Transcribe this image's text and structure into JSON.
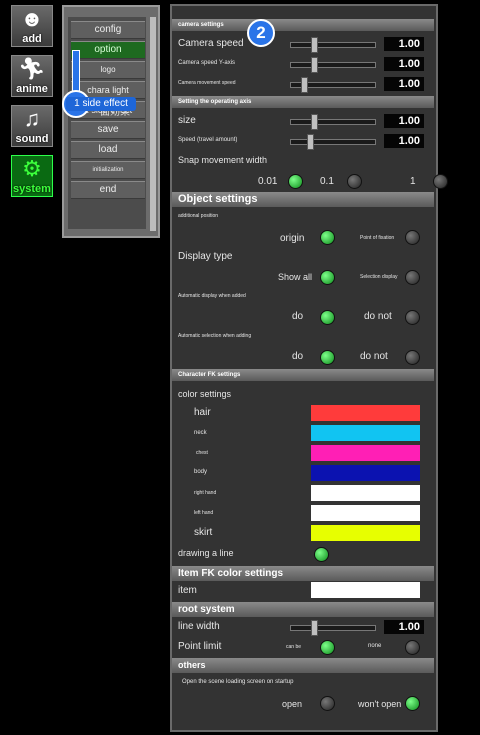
{
  "sidebar": {
    "items": [
      {
        "label": "add",
        "icon": "avatar-icon"
      },
      {
        "label": "anime",
        "icon": "running-figure-icon"
      },
      {
        "label": "sound",
        "icon": "music-note-icon"
      },
      {
        "label": "system",
        "icon": "gears-icon"
      }
    ]
  },
  "menu": {
    "items": [
      "config",
      "option",
      "logo",
      "chara light",
      "1 side effect",
      "save",
      "load",
      "initialization",
      "end"
    ],
    "overlay_text": "面効果"
  },
  "annotations": {
    "badge_1": "1",
    "badge_2": "2",
    "tooltip": "1 side effect"
  },
  "camera": {
    "header": "camera settings",
    "speed_label": "Camera speed",
    "speed_value": "1.00",
    "speed_y_label": "Camera speed Y-axis",
    "speed_y_value": "1.00",
    "move_label": "Camera movement speed",
    "move_value": "1.00"
  },
  "operating_axis": {
    "header": "Setting the operating axis",
    "size_label": "size",
    "size_value": "1.00",
    "speed_label": "Speed (travel amount)",
    "speed_value": "1.00",
    "snap_label": "Snap movement width",
    "snap_options": [
      "0.01",
      "0.1",
      "1"
    ],
    "snap_selected": "0.01"
  },
  "object_settings": {
    "header": "Object settings",
    "add_pos_label": "additional position",
    "add_pos_opt1": "origin",
    "add_pos_opt2": "Point of fixation",
    "display_label": "Display type",
    "display_opt1": "Show all",
    "display_opt2": "Selection display",
    "auto_display_label": "Automatic display when added",
    "auto_display_opt1": "do",
    "auto_display_opt2": "do not",
    "auto_select_label": "Automatic selection when adding",
    "auto_select_opt1": "do",
    "auto_select_opt2": "do not"
  },
  "character_fk": {
    "header": "Character FK settings",
    "color_label": "color settings",
    "parts": [
      {
        "label": "hair",
        "color": "#ff3b3b"
      },
      {
        "label": "neck",
        "color": "#11c4f2"
      },
      {
        "label": "chest",
        "color": "#ff1fb5"
      },
      {
        "label": "body",
        "color": "#0b12b0"
      },
      {
        "label": "right hand",
        "color": "#ffffff"
      },
      {
        "label": "left hand",
        "color": "#ffffff"
      },
      {
        "label": "skirt",
        "color": "#e7ff00"
      }
    ],
    "draw_line_label": "drawing a line"
  },
  "item_fk": {
    "header": "Item FK color settings",
    "item_label": "item",
    "item_color": "#ffffff"
  },
  "root_system": {
    "header": "root system",
    "line_width_label": "line width",
    "line_width_value": "1.00",
    "point_limit_label": "Point limit",
    "point_opt1": "can be",
    "point_opt2": "none"
  },
  "others": {
    "header": "others",
    "startup_label": "Open the scene loading screen on startup",
    "opt1": "open",
    "opt2": "won't open"
  },
  "colors": {
    "accent_green": "#1e9a2a",
    "badge_blue": "#2a74e8"
  }
}
